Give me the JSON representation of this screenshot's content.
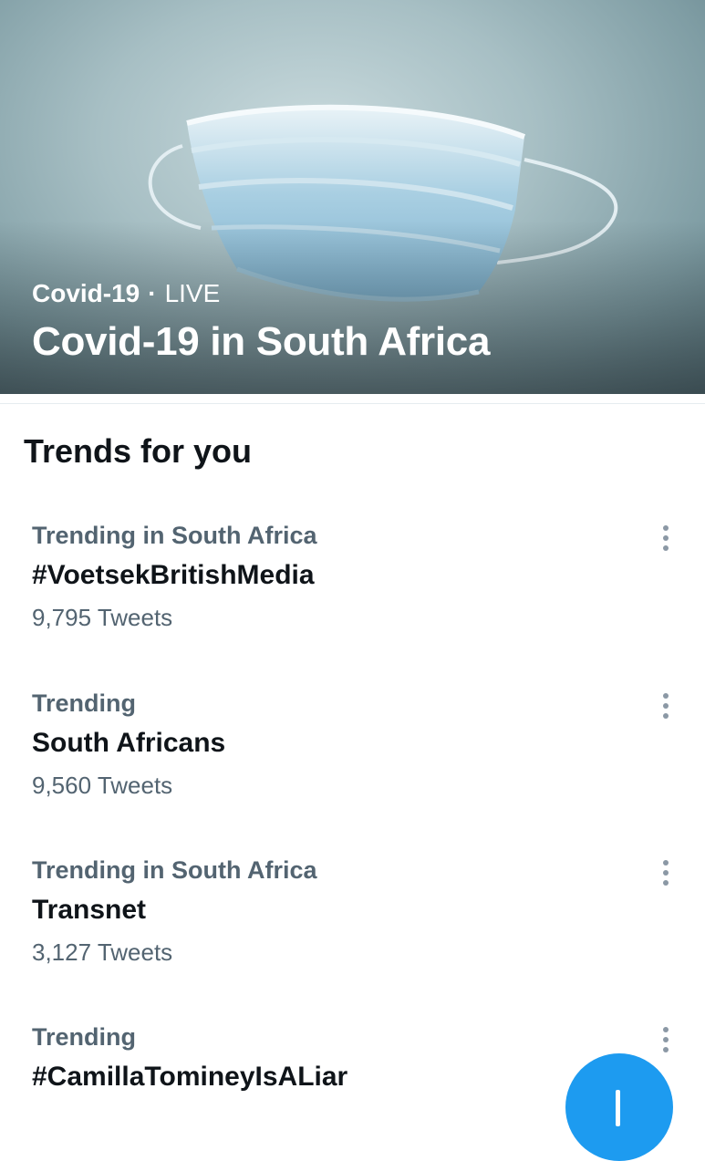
{
  "hero": {
    "category": "Covid-19",
    "separator": "·",
    "status": "LIVE",
    "title": "Covid-19 in South Africa"
  },
  "trends_section": {
    "heading": "Trends for you",
    "items": [
      {
        "context": "Trending in South Africa",
        "name": "#VoetsekBritishMedia",
        "count": "9,795 Tweets"
      },
      {
        "context": "Trending",
        "name": "South Africans",
        "count": "9,560 Tweets"
      },
      {
        "context": "Trending in South Africa",
        "name": "Transnet",
        "count": "3,127 Tweets"
      },
      {
        "context": "Trending",
        "name": "#CamillaTomineyIsALiar",
        "count": ""
      }
    ]
  },
  "colors": {
    "accent": "#1d9bf0",
    "primary_text": "#0f1419",
    "secondary_text": "#536471"
  },
  "icons": {
    "more": "more-vertical-icon",
    "compose": "plus-icon"
  }
}
